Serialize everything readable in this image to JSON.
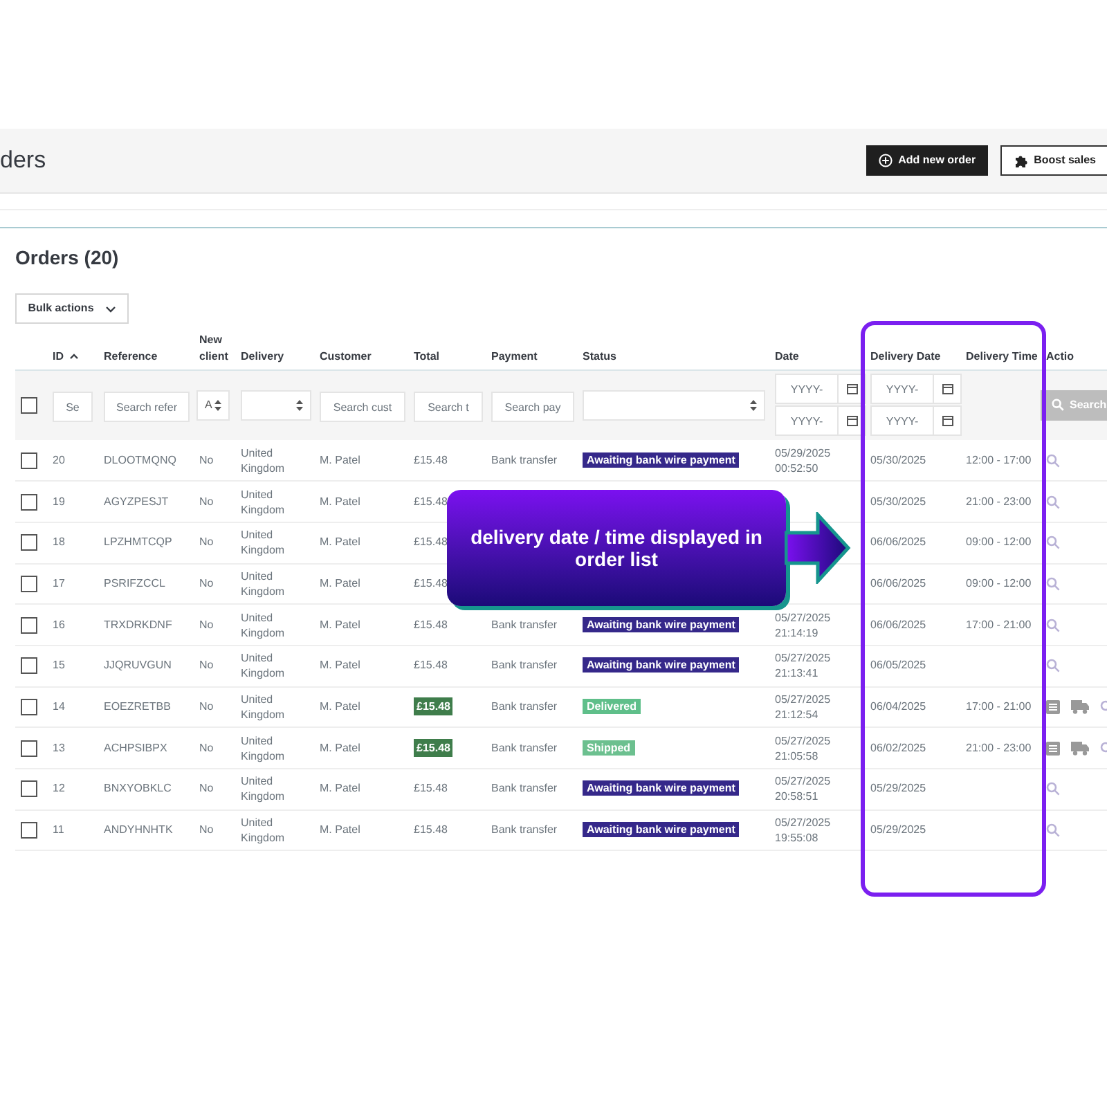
{
  "page_title": "ders",
  "header_buttons": [
    {
      "label": "Add new order",
      "kind": "primary"
    },
    {
      "label": "Boost sales",
      "kind": "secondary"
    }
  ],
  "section_title": "Orders (20)",
  "bulk_actions": "Bulk actions",
  "table": {
    "columns": [
      {
        "label": "ID",
        "sorted": true
      },
      {
        "label": "Reference",
        "sorted": false
      },
      {
        "label": "New client",
        "sorted": false
      },
      {
        "label": "Delivery",
        "sorted": false
      },
      {
        "label": "Customer",
        "sorted": false
      },
      {
        "label": "Total",
        "sorted": false
      },
      {
        "label": "Payment",
        "sorted": false
      },
      {
        "label": "Status",
        "sorted": false
      },
      {
        "label": "Date",
        "sorted": false
      },
      {
        "label": "Delivery Date",
        "sorted": false
      },
      {
        "label": "Delivery Time",
        "sorted": false
      },
      {
        "label": "Actio",
        "sorted": false
      }
    ],
    "filters": {
      "select_all_checked": false,
      "id": {
        "placeholder": "Se"
      },
      "reference": {
        "placeholder": "Search refer"
      },
      "new_client": "A",
      "customer": {
        "placeholder": "Search cust"
      },
      "total": {
        "placeholder": "Search t"
      },
      "payment": {
        "placeholder": "Search pay"
      },
      "date_from": {
        "placeholder": "YYYY-"
      },
      "date_to": {
        "placeholder": "YYYY-"
      },
      "delivery_from": {
        "placeholder": "YYYY-"
      },
      "delivery_to": {
        "placeholder": "YYYY-"
      },
      "search_button": "Search"
    },
    "rows": [
      {
        "checked": false,
        "id": "20",
        "reference": "DLOOTMQNQ",
        "new_client": "No",
        "delivery": "United Kingdom",
        "customer": "M. Patel",
        "total": "£15.48",
        "total_highlighted": false,
        "payment": "Bank transfer",
        "status": {
          "label": "Awaiting bank wire payment",
          "color": "#35288a"
        },
        "date": [
          "05/29/2025",
          "00:52:50"
        ],
        "delivery_date": "05/30/2025",
        "delivery_time": "12:00 - 17:00",
        "shipping_actions": false
      },
      {
        "checked": false,
        "id": "19",
        "reference": "AGYZPESJT",
        "new_client": "No",
        "delivery": "United Kingdom",
        "customer": "M. Patel",
        "total": "£15.48",
        "total_highlighted": false,
        "delivery_date": "05/30/2025",
        "delivery_time": "21:00 - 23:00",
        "shipping_actions": false
      },
      {
        "checked": false,
        "id": "18",
        "reference": "LPZHMTCQP",
        "new_client": "No",
        "delivery": "United Kingdom",
        "customer": "M. Patel",
        "total": "£15.48",
        "total_highlighted": false,
        "delivery_date": "06/06/2025",
        "delivery_time": "09:00 - 12:00",
        "shipping_actions": false
      },
      {
        "checked": false,
        "id": "17",
        "reference": "PSRIFZCCL",
        "new_client": "No",
        "delivery": "United Kingdom",
        "customer": "M. Patel",
        "total": "£15.48",
        "total_highlighted": false,
        "delivery_date": "06/06/2025",
        "delivery_time": "09:00 - 12:00",
        "shipping_actions": false
      },
      {
        "checked": false,
        "id": "16",
        "reference": "TRXDRKDNF",
        "new_client": "No",
        "delivery": "United Kingdom",
        "customer": "M. Patel",
        "total": "£15.48",
        "total_highlighted": false,
        "payment": "Bank transfer",
        "status": {
          "label": "Awaiting bank wire payment",
          "color": "#35288a"
        },
        "date": [
          "05/27/2025",
          "21:14:19"
        ],
        "delivery_date": "06/06/2025",
        "delivery_time": "17:00 - 21:00",
        "shipping_actions": false
      },
      {
        "checked": false,
        "id": "15",
        "reference": "JJQRUVGUN",
        "new_client": "No",
        "delivery": "United Kingdom",
        "customer": "M. Patel",
        "total": "£15.48",
        "total_highlighted": false,
        "payment": "Bank transfer",
        "status": {
          "label": "Awaiting bank wire payment",
          "color": "#35288a"
        },
        "date": [
          "05/27/2025",
          "21:13:41"
        ],
        "delivery_date": "06/05/2025",
        "shipping_actions": false
      },
      {
        "checked": false,
        "id": "14",
        "reference": "EOEZRETBB",
        "new_client": "No",
        "delivery": "United Kingdom",
        "customer": "M. Patel",
        "total": "£15.48",
        "total_highlighted": true,
        "payment": "Bank transfer",
        "status": {
          "label": "Delivered",
          "color": "#5fbf8a"
        },
        "date": [
          "05/27/2025",
          "21:12:54"
        ],
        "delivery_date": "06/04/2025",
        "delivery_time": "17:00 - 21:00",
        "shipping_actions": true
      },
      {
        "checked": false,
        "id": "13",
        "reference": "ACHPSIBPX",
        "new_client": "No",
        "delivery": "United Kingdom",
        "customer": "M. Patel",
        "total": "£15.48",
        "total_highlighted": true,
        "payment": "Bank transfer",
        "status": {
          "label": "Shipped",
          "color": "#6cc08f"
        },
        "date": [
          "05/27/2025",
          "21:05:58"
        ],
        "delivery_date": "06/02/2025",
        "delivery_time": "21:00 - 23:00",
        "shipping_actions": true
      },
      {
        "checked": false,
        "id": "12",
        "reference": "BNXYOBKLC",
        "new_client": "No",
        "delivery": "United Kingdom",
        "customer": "M. Patel",
        "total": "£15.48",
        "total_highlighted": false,
        "payment": "Bank transfer",
        "status": {
          "label": "Awaiting bank wire payment",
          "color": "#35288a"
        },
        "date": [
          "05/27/2025",
          "20:58:51"
        ],
        "delivery_date": "05/29/2025",
        "shipping_actions": false
      },
      {
        "checked": false,
        "id": "11",
        "reference": "ANDYHNHTK",
        "new_client": "No",
        "delivery": "United Kingdom",
        "customer": "M. Patel",
        "total": "£15.48",
        "total_highlighted": false,
        "payment": "Bank transfer",
        "status": {
          "label": "Awaiting bank wire payment",
          "color": "#35288a"
        },
        "date": [
          "05/27/2025",
          "19:55:08"
        ],
        "delivery_date": "05/29/2025",
        "shipping_actions": false
      }
    ]
  },
  "callout": "delivery date / time displayed in order list"
}
